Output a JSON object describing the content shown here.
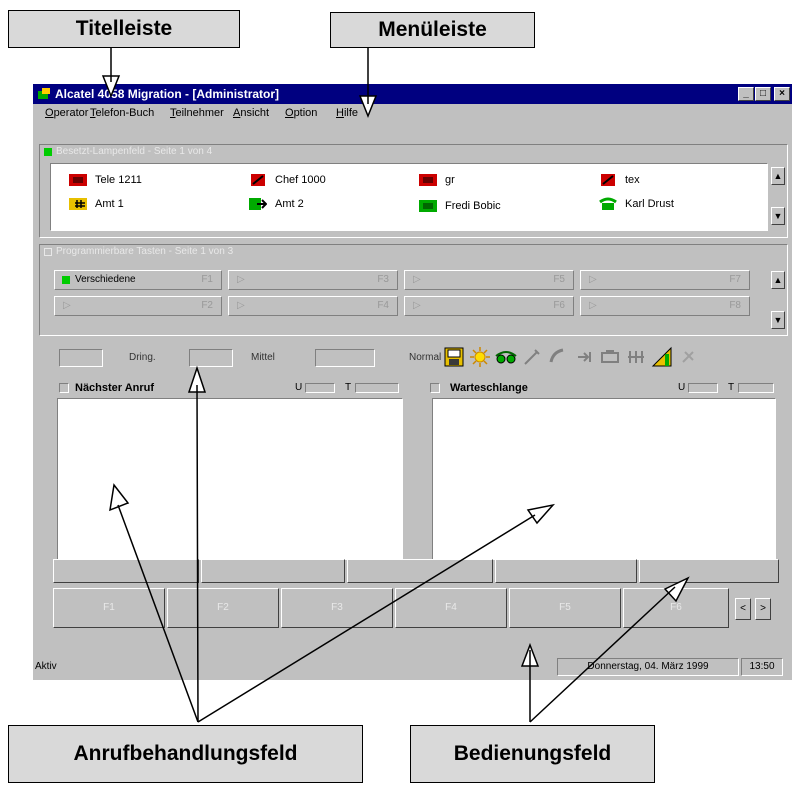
{
  "callouts": {
    "title_bar": "Titelleiste",
    "menu_bar": "Menüleiste",
    "call_handling": "Anrufbehandlungsfeld",
    "operator_panel": "Bedienungsfeld"
  },
  "window": {
    "title": "Alcatel 4058 Migration - [Administrator]",
    "buttons": [
      "minimize",
      "maximize",
      "close"
    ]
  },
  "menu": [
    "Operator",
    "Telefon-Buch",
    "Teilnehmer",
    "Ansicht",
    "Option",
    "Hilfe"
  ],
  "favorites": {
    "header": "Besetzt-Lampenfeld - Seite 1 von 4",
    "entries": [
      {
        "label": "Tele 1211",
        "icon": "phone-red-icon",
        "color": "#cc0000"
      },
      {
        "label": "Chef 1000",
        "icon": "phone-forward-icon",
        "color": "#cc0000"
      },
      {
        "label": "gr",
        "icon": "phone-red-icon",
        "color": "#cc0000"
      },
      {
        "label": "tex",
        "icon": "phone-forward-icon",
        "color": "#cc0000"
      },
      {
        "label": "Amt 1",
        "icon": "trunk-busy-icon",
        "color": "#e8c000"
      },
      {
        "label": "Amt 2",
        "icon": "trunk-arrow-icon",
        "color": "#00aa00"
      },
      {
        "label": "Fredi Bobic",
        "icon": "phone-green-icon",
        "color": "#00aa00"
      },
      {
        "label": "Karl Drust",
        "icon": "telephone-icon",
        "color": "#00aa00"
      }
    ]
  },
  "programmable": {
    "header": "Programmierbare Tasten - Seite 1 von 3",
    "keys": [
      {
        "label": "Verschiedene",
        "key": "F1"
      },
      {
        "label": "",
        "key": "F2"
      },
      {
        "label": "",
        "key": "F3"
      },
      {
        "label": "",
        "key": "F4"
      },
      {
        "label": "",
        "key": "F5"
      },
      {
        "label": "",
        "key": "F6"
      },
      {
        "label": "",
        "key": "F7"
      },
      {
        "label": "",
        "key": "F8"
      }
    ]
  },
  "priority": {
    "dring": "Dring.",
    "mittel": "Mittel",
    "normal": "Normal"
  },
  "toolbar_icons": [
    "save-icon",
    "sun-icon",
    "glasses-icon",
    "tools-icon",
    "phone-handset-icon",
    "transfer-icon",
    "conference-icon",
    "calculator-icon",
    "signal-icon",
    "settings-icon"
  ],
  "queues": {
    "next_call": {
      "title": "Nächster Anruf",
      "u": "U",
      "t": "T"
    },
    "waiting": {
      "title": "Warteschlange",
      "u": "U",
      "t": "T"
    }
  },
  "function_keys": [
    "F1",
    "F2",
    "F3",
    "F4",
    "F5",
    "F6"
  ],
  "nav": {
    "prev": "<",
    "next": ">"
  },
  "status": {
    "left": "Aktiv",
    "date": "Donnerstag, 04. März 1999",
    "time": "13:50"
  }
}
